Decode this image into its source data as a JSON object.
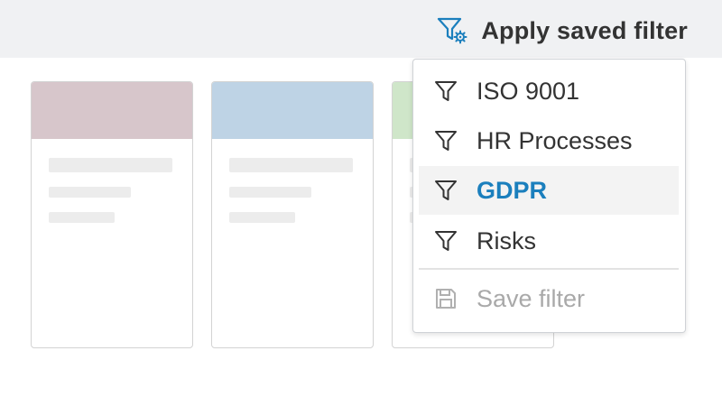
{
  "header": {
    "apply_filter_label": "Apply saved filter",
    "apply_icon": "filter-gear-icon",
    "accent_color": "#1b7fbd"
  },
  "cards": [
    {
      "header_color": "#d7c6cb"
    },
    {
      "header_color": "#bed3e5"
    },
    {
      "header_color": "#cfe6c9"
    }
  ],
  "saved_filters": {
    "items": [
      {
        "label": "ISO 9001",
        "icon": "filter-icon",
        "active": false
      },
      {
        "label": "HR Processes",
        "icon": "filter-icon",
        "active": false
      },
      {
        "label": "GDPR",
        "icon": "filter-icon",
        "active": true
      },
      {
        "label": "Risks",
        "icon": "filter-icon",
        "active": false
      }
    ],
    "save_label": "Save filter",
    "save_icon": "save-disk-icon",
    "save_disabled": true
  }
}
